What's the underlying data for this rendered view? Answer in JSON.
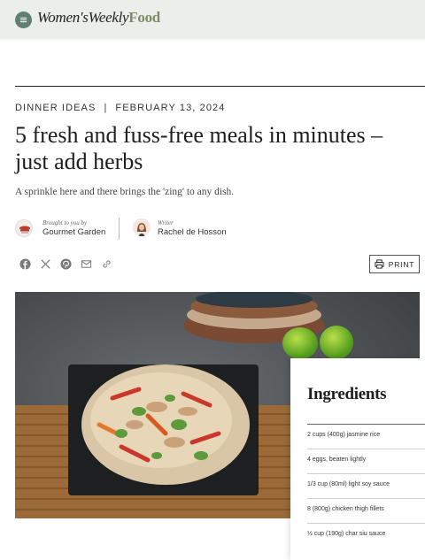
{
  "header": {
    "logo_brand": "Women'sWeekly",
    "logo_food": "Food",
    "menu_icon": "hamburger-menu-icon"
  },
  "article": {
    "category": "DINNER IDEAS",
    "separator": "|",
    "date": "FEBRUARY 13, 2024",
    "title": "5 fresh and fuss-free meals in minutes – just add herbs",
    "dek": "A sprinkle here and there brings the 'zing' to any dish."
  },
  "byline": {
    "sponsor_label": "Brought to you by",
    "sponsor_name": "Gourmet Garden",
    "writer_label": "Writer",
    "writer_name": "Rachel de Hosson"
  },
  "share": {
    "icons": [
      "facebook-icon",
      "x-icon",
      "pinterest-icon",
      "email-icon",
      "link-icon"
    ]
  },
  "print": {
    "label": "PRINT"
  },
  "ingredients": {
    "title": "Ingredients",
    "items": [
      "2 cups (400g) jasmine rice",
      "4 eggs, beaten lightly",
      "1/3 cup (80ml) light soy sauce",
      "8 (800g) chicken thigh fillets",
      "½ cup (190g) char siu sauce"
    ]
  },
  "colors": {
    "brand_green": "#5f7f6f",
    "food_green": "#7d8e67",
    "header_bg": "#eceeec"
  }
}
